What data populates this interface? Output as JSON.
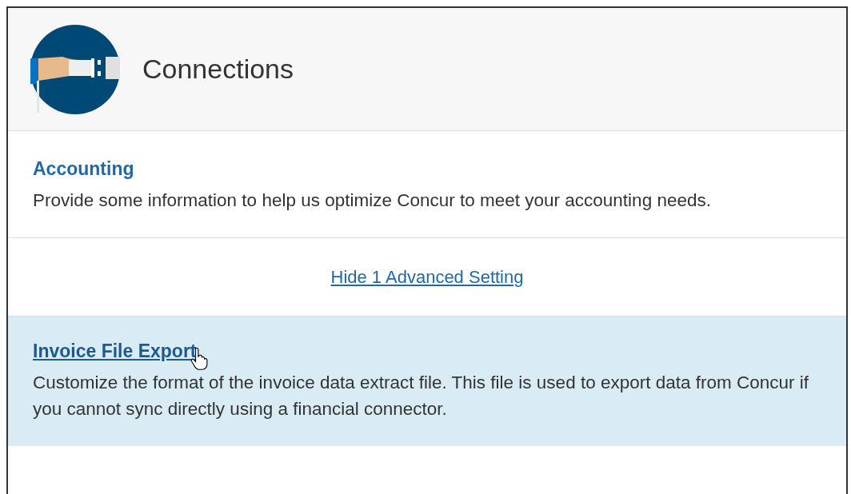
{
  "header": {
    "title": "Connections"
  },
  "sections": [
    {
      "title": "Accounting",
      "description": "Provide some information to help us optimize Concur to meet your accounting needs.",
      "highlighted": false,
      "hovered": false
    }
  ],
  "toggle_link": "Hide 1 Advanced Setting",
  "advanced_sections": [
    {
      "title": "Invoice File Export",
      "description": "Customize the format of the invoice data extract file. This file is used to export data from Concur if you cannot sync directly using a financial connector.",
      "highlighted": true,
      "hovered": true
    }
  ]
}
